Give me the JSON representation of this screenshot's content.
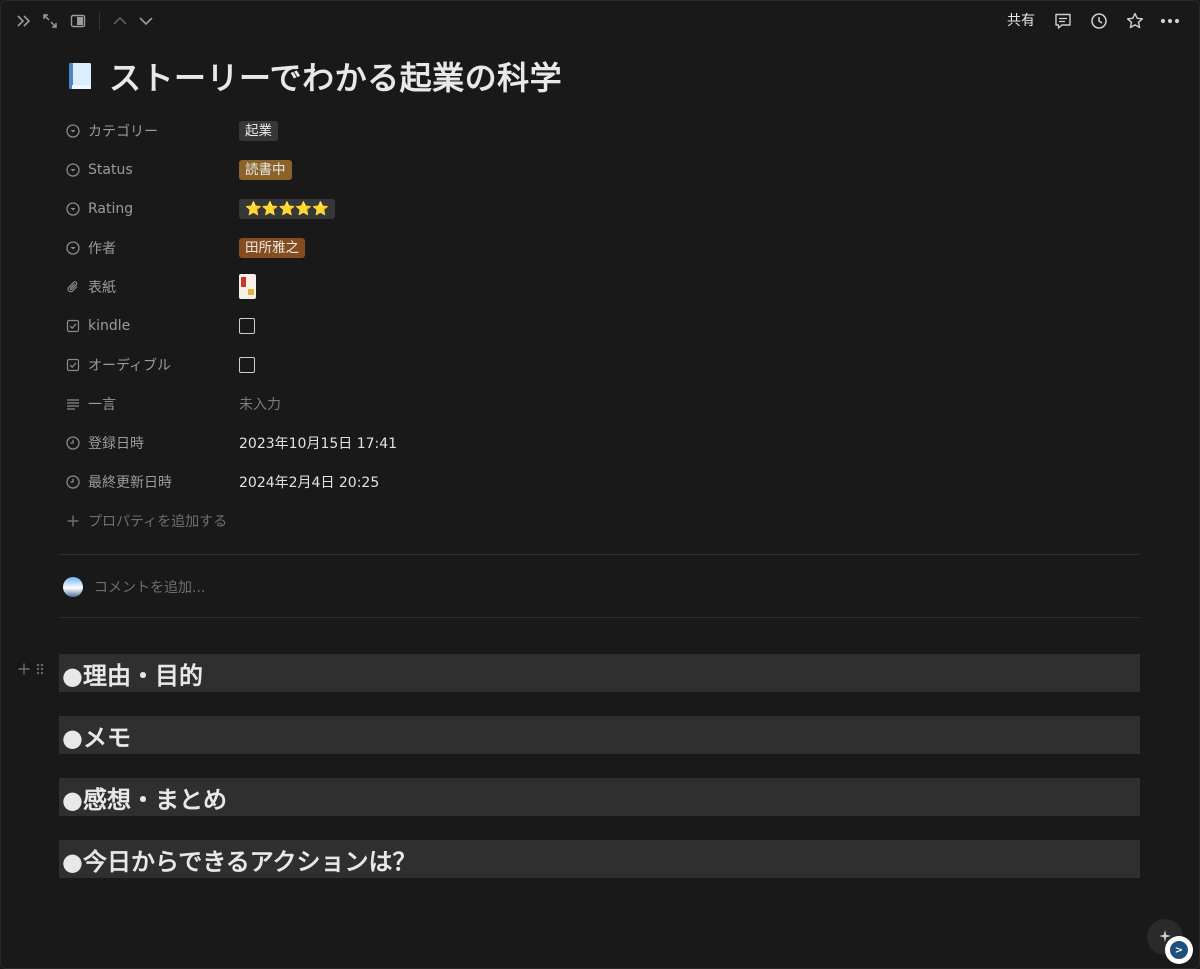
{
  "topbar": {
    "share_label": "共有",
    "icons": [
      "sidebar-expand-icon",
      "fullscreen-icon",
      "panel-icon",
      "chevron-up-icon",
      "chevron-down-icon",
      "comment-icon",
      "history-icon",
      "star-icon",
      "more-icon"
    ]
  },
  "page": {
    "icon": "book-icon",
    "title": "ストーリーでわかる起業の科学"
  },
  "properties": [
    {
      "name": "カテゴリー",
      "icon": "select-icon",
      "value": "起業",
      "kind": "tag",
      "color": "#373737"
    },
    {
      "name": "Status",
      "icon": "select-icon",
      "value": "読書中",
      "kind": "tag",
      "color": "#89632a"
    },
    {
      "name": "Rating",
      "icon": "select-icon",
      "value": "⭐⭐⭐⭐⭐",
      "kind": "stars",
      "color": "#373737"
    },
    {
      "name": "作者",
      "icon": "select-icon",
      "value": "田所雅之",
      "kind": "tag",
      "color": "#854c1d"
    },
    {
      "name": "表紙",
      "icon": "paperclip-icon",
      "value": "",
      "kind": "file"
    },
    {
      "name": "kindle",
      "icon": "checkbox-icon",
      "value": "",
      "kind": "checkbox",
      "checked": false
    },
    {
      "name": "オーディブル",
      "icon": "checkbox-icon",
      "value": "",
      "kind": "checkbox",
      "checked": false
    },
    {
      "name": "一言",
      "icon": "text-lines-icon",
      "value": "未入力",
      "kind": "empty"
    },
    {
      "name": "登録日時",
      "icon": "clock-icon",
      "value": "2023年10月15日 17:41",
      "kind": "text"
    },
    {
      "name": "最終更新日時",
      "icon": "clock-icon",
      "value": "2024年2月4日 20:25",
      "kind": "text"
    }
  ],
  "add_property_label": "プロパティを追加する",
  "comment": {
    "placeholder": "コメントを追加..."
  },
  "headings": [
    "●理由・目的",
    "●メモ",
    "●感想・まとめ",
    "●今日からできるアクションは？"
  ],
  "colors": {
    "background": "#191919",
    "heading_background": "#2f2f2f",
    "tag_yellow": "#89632a",
    "tag_orange": "#854c1d",
    "tag_gray": "#373737"
  }
}
